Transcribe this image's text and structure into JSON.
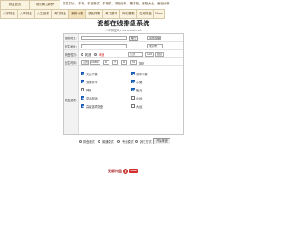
{
  "nav": {
    "row1": [
      {
        "label": "排盘首页",
        "active": false
      },
      {
        "label": "现代周公解梦",
        "active": false
      }
    ],
    "row1_text": "姓名打分、手相、手相测试、手相学、手相分析、看手相、面相大全、面相分析 ...",
    "row2": [
      {
        "label": "八字排盘"
      },
      {
        "label": "六爻排盘"
      },
      {
        "label": "六壬起课"
      },
      {
        "label": "奇门排盘"
      },
      {
        "label": "紫微斗数"
      },
      {
        "label": "铁板神数"
      },
      {
        "label": "奇门遁甲"
      },
      {
        "label": "梅花易数"
      },
      {
        "label": "在线排盘"
      },
      {
        "label": "More"
      }
    ]
  },
  "page": {
    "title": "瓷都在线排盘系统",
    "subtitle": "八字排盘 By www.cidu.net"
  },
  "form": {
    "name_label": "您的姓名:",
    "name_value": "",
    "name_button": "取名",
    "name_select": "双姓选择",
    "address_label": "出生地址:",
    "address_value": "",
    "address_select": "北京市",
    "gender_label": "排盘性别:",
    "gender_male": "乾造",
    "gender_female": "坤造",
    "time_type_label": "排盘时间:",
    "time_type_select": "公历",
    "longitude_value": "120",
    "longitude_select": "经度",
    "date_label": "出生时间:",
    "year": "1982",
    "month": "6",
    "day": "7",
    "hour": "6",
    "minute": "50",
    "date_suffix": "排时",
    "options_label": "排盘选项:",
    "options": [
      {
        "label": "天运不变",
        "checked": true
      },
      {
        "label": "流年不变",
        "checked": true
      },
      {
        "label": "流限精平",
        "checked": true
      },
      {
        "label": "小限",
        "checked": true
      },
      {
        "label": "神煞",
        "checked": false
      },
      {
        "label": "胎元",
        "checked": true
      },
      {
        "label": "显示起运",
        "checked": true
      },
      {
        "label": "小运",
        "checked": false
      },
      {
        "label": "高级选项排盘",
        "checked": true
      },
      {
        "label": "大运",
        "checked": false
      }
    ]
  },
  "modes": {
    "items": [
      {
        "label": "排盘模式",
        "selected": false
      },
      {
        "label": "普通模式",
        "selected": true
      },
      {
        "label": "专业模式",
        "selected": false
      },
      {
        "label": "其它方式",
        "selected": false
      }
    ],
    "submit": "开始排盘"
  },
  "footer": {
    "logo_text": "瓷都排盘",
    "badge": "cidu"
  },
  "colors": {
    "nav_bg": "#faf3df",
    "nav_border": "#d8c9a8",
    "checkbox": "#1f6fd0",
    "logo_red": "#d32f2f"
  }
}
